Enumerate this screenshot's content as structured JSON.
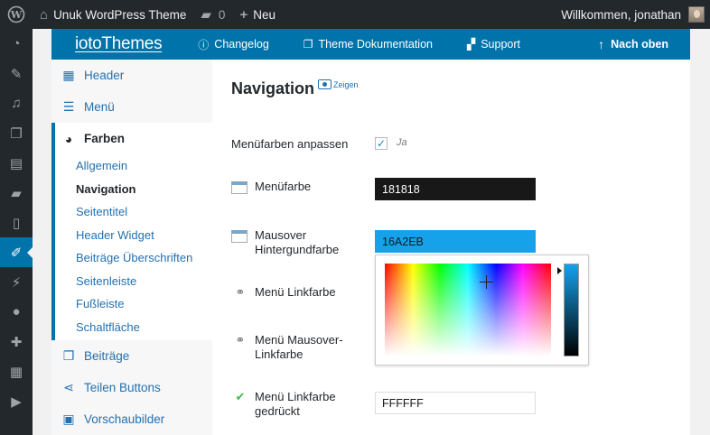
{
  "adminbar": {
    "site_name": "Unuk WordPress Theme",
    "comments_count": "0",
    "new_label": "Neu",
    "greeting": "Willkommen, jonathan"
  },
  "admin_menu_icons": [
    "dashboard-icon",
    "pin-icon",
    "media-icon",
    "pages-icon",
    "comments-icon",
    "feedback-icon",
    "appearance-icon",
    "plugins-icon",
    "users-icon",
    "tools-icon",
    "settings-icon",
    "play-icon"
  ],
  "themebar": {
    "brand": "iotoThemes",
    "links": [
      {
        "label": "Changelog",
        "icon": "info-icon"
      },
      {
        "label": "Theme Dokumentation",
        "icon": "documents-icon"
      },
      {
        "label": "Support",
        "icon": "chat-icon"
      }
    ],
    "top_label": "Nach oben"
  },
  "sidebar": {
    "header": "Header",
    "menu": "Menü",
    "colors": "Farben",
    "color_items": [
      "Allgemein",
      "Navigation",
      "Seitentitel",
      "Header Widget",
      "Beiträge Überschriften",
      "Seitenleiste",
      "Fußleiste",
      "Schaltfläche"
    ],
    "after": [
      {
        "label": "Beiträge",
        "icon": "posts-icon"
      },
      {
        "label": "Teilen Buttons",
        "icon": "share-icon"
      },
      {
        "label": "Vorschaubilder",
        "icon": "image-icon"
      }
    ]
  },
  "main": {
    "title": "Navigation",
    "show_label": "Zeigen",
    "custom_colors_label": "Menüfarben anpassen",
    "custom_colors_value": "Ja",
    "fields": [
      {
        "label": "Menüfarbe",
        "value": "181818"
      },
      {
        "label_line1": "Mausover",
        "label_line2": "Hintergundfarbe",
        "value": "16A2EB"
      },
      {
        "label": "Menü Linkfarbe"
      },
      {
        "label_line1": "Menü Mausover-",
        "label_line2": "Linkfarbe"
      },
      {
        "label_line1": "Menü Linkfarbe",
        "label_line2": "gedrückt",
        "value": "FFFFFF"
      }
    ]
  },
  "colors": {
    "admin_dark": "#23282d",
    "accent": "#0073aa",
    "hover_bg": "#16a2eb",
    "menu_color": "#181818"
  }
}
